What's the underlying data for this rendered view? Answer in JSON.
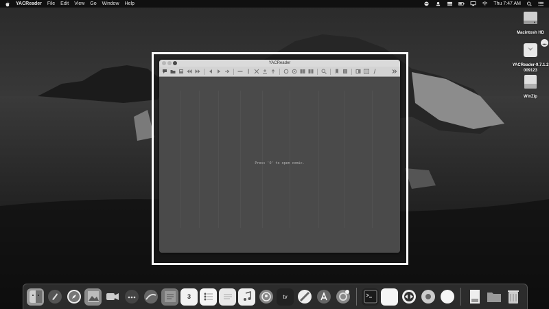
{
  "menubar": {
    "app_name": "YACReader",
    "menus": [
      "File",
      "Edit",
      "View",
      "Go",
      "Window",
      "Help"
    ],
    "clock": "Thu 7:47 AM"
  },
  "desktop": {
    "icons": [
      {
        "label": "Macintosh HD"
      },
      {
        "label": "YACReader-9.7.1.2\n009123"
      },
      {
        "label": "WinZip"
      }
    ]
  },
  "window": {
    "title": "YACReader",
    "toolbar_icons": [
      "open-comic-icon",
      "open-folder-icon",
      "save-image-icon",
      "open-previous-comic-icon",
      "open-next-comic-icon",
      "previous-page-icon",
      "next-page-icon",
      "go-to-page-icon",
      "fit-width-icon",
      "fit-height-icon",
      "reset-fit-icon",
      "zoom-in-icon",
      "zoom-out-icon",
      "rotate-left-icon",
      "rotate-right-icon",
      "double-page-icon",
      "manga-mode-icon",
      "magnifying-glass-icon",
      "bookmark-icon",
      "bookmarks-list-icon",
      "comic-info-icon",
      "shortcuts-icon",
      "options-icon",
      "help-icon",
      "toolbar-overflow-icon"
    ],
    "viewer_hint": "Press 'O' to open comic."
  },
  "dock": {
    "calendar_day": "3",
    "tv_label": "tv"
  }
}
